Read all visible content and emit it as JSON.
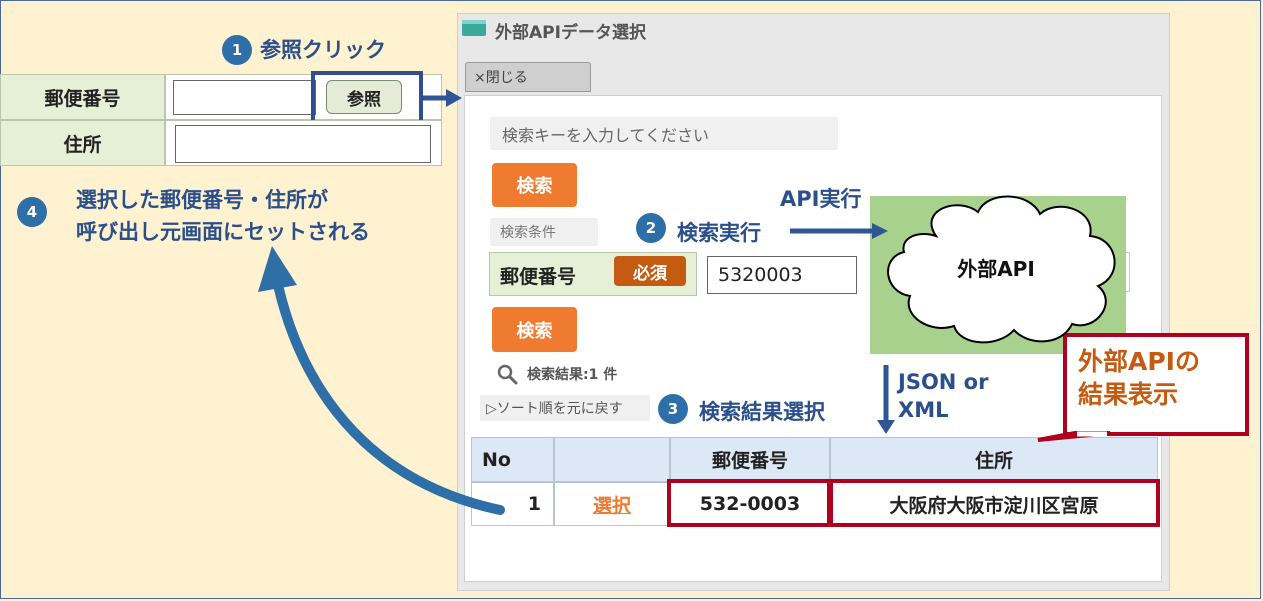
{
  "steps": {
    "step1": {
      "badge": "1",
      "text": "参照クリック"
    },
    "step2": {
      "badge": "2",
      "text": "検索実行"
    },
    "step3": {
      "badge": "3",
      "text": "検索結果選択"
    },
    "step4": {
      "badge": "4",
      "line1": "選択した郵便番号・住所が",
      "line2": "呼び出し元画面にセットされる"
    }
  },
  "caller_form": {
    "zip_label": "郵便番号",
    "address_label": "住所",
    "ref_button": "参照"
  },
  "dialog": {
    "title": "外部APIデータ選択",
    "close_button": "×閉じる",
    "search_key_placeholder": "検索キーを入力してください",
    "search_button": "検索",
    "conditions_label": "検索条件",
    "zip_label": "郵便番号",
    "required_badge": "必須",
    "zip_value": "5320003",
    "search_button_2": "検索",
    "result_count": "検索結果:1 件",
    "sort_reset": "▷ソート順を元に戻す",
    "table": {
      "headers": [
        "No",
        "",
        "郵便番号",
        "住所"
      ],
      "rows": [
        {
          "no": "1",
          "select": "選択",
          "zip": "532-0003",
          "address": "大阪府大阪市淀川区宮原"
        }
      ]
    }
  },
  "api": {
    "exec_label": "API実行",
    "cloud_label": "外部API",
    "format_line1": "JSON or",
    "format_line2": "XML"
  },
  "callout": {
    "line1": "外部APIの",
    "line2": "結果表示"
  },
  "colors": {
    "background": "#fff2d1",
    "step_blue": "#2d6fa6",
    "caption_blue": "#2a4f8a",
    "highlight_red": "#b00020",
    "accent_orange": "#ee7b30",
    "api_green": "#a9d18e"
  }
}
